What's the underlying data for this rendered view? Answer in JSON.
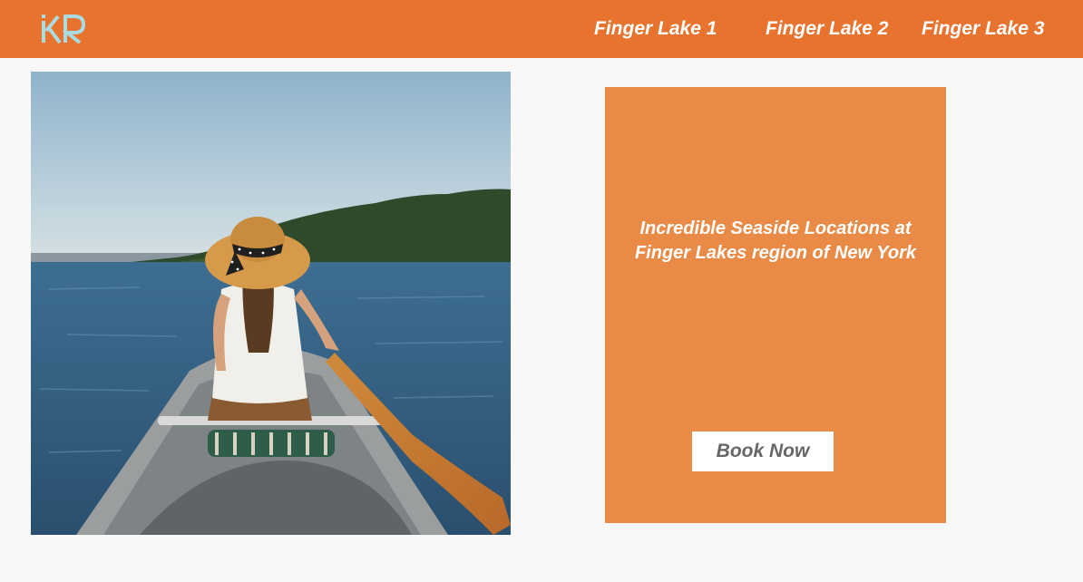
{
  "header": {
    "logo_text": "KR",
    "nav": [
      {
        "label": "Finger Lake 1"
      },
      {
        "label": "Finger Lake 2"
      },
      {
        "label": "Finger Lake 3"
      }
    ]
  },
  "hero": {
    "image_icon": "canoe-lake-photo"
  },
  "promo": {
    "headline_line1": "Incredible Seaside Locations at",
    "headline_line2": "Finger Lakes region of New York",
    "cta_label": "Book Now"
  },
  "colors": {
    "header_bg": "#e8732f",
    "promo_bg": "#e98b47",
    "logo": "#a9dbe0",
    "button_text": "#666666"
  }
}
